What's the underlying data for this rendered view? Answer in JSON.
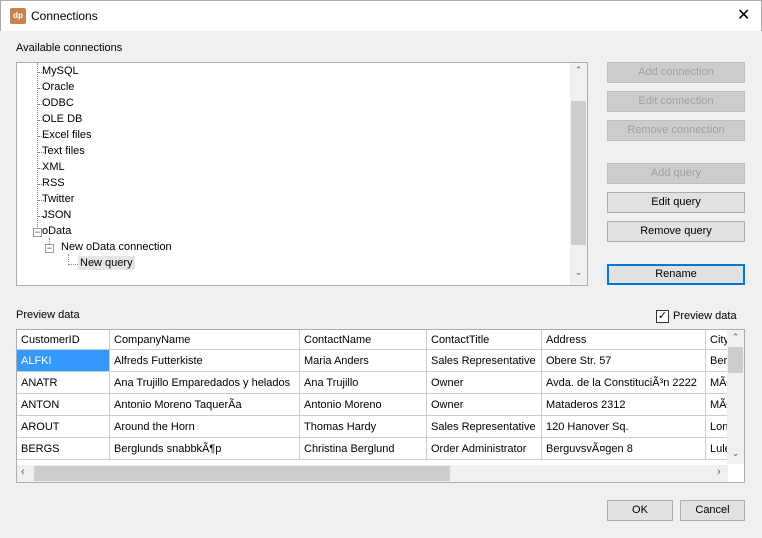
{
  "window": {
    "title": "Connections",
    "logo": "dp",
    "close": "✕"
  },
  "tree": {
    "label": "Available connections",
    "items": [
      "MySQL",
      "Oracle",
      "ODBC",
      "OLE DB",
      "Excel files",
      "Text files",
      "XML",
      "RSS",
      "Twitter",
      "JSON"
    ],
    "odata": "oData",
    "connection": "New oData connection",
    "query": "New query"
  },
  "buttons": {
    "add_connection": "Add connection",
    "edit_connection": "Edit connection",
    "remove_connection": "Remove connection",
    "add_query": "Add query",
    "edit_query": "Edit query",
    "remove_query": "Remove query",
    "rename": "Rename",
    "ok": "OK",
    "cancel": "Cancel"
  },
  "preview": {
    "label": "Preview data",
    "checkbox_label": "Preview data",
    "checked": true,
    "columns": [
      "CustomerID",
      "CompanyName",
      "ContactName",
      "ContactTitle",
      "Address",
      "City"
    ],
    "rows": [
      [
        "ALFKI",
        "Alfreds Futterkiste",
        "Maria Anders",
        "Sales Representative",
        "Obere Str. 57",
        "Berlin"
      ],
      [
        "ANATR",
        "Ana Trujillo Emparedados y helados",
        "Ana Trujillo",
        "Owner",
        "Avda. de la ConstituciÃ³n 2222",
        "MÃ©xico D.F."
      ],
      [
        "ANTON",
        "Antonio Moreno TaquerÃ­a",
        "Antonio Moreno",
        "Owner",
        "Mataderos  2312",
        "MÃ©xico D.F."
      ],
      [
        "AROUT",
        "Around the Horn",
        "Thomas Hardy",
        "Sales Representative",
        "120 Hanover Sq.",
        "London"
      ],
      [
        "BERGS",
        "Berglunds snabbkÃ¶p",
        "Christina Berglund",
        "Order Administrator",
        "BerguvsvÃ¤gen  8",
        "LuleÃ¥"
      ]
    ]
  }
}
